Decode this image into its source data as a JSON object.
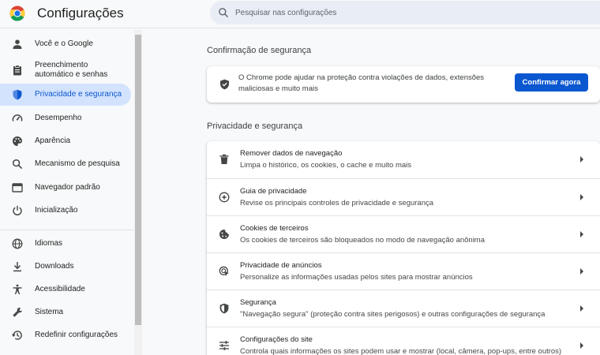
{
  "header": {
    "title": "Configurações",
    "search_placeholder": "Pesquisar nas configurações"
  },
  "sidebar": {
    "items": [
      {
        "label": "Você e o Google",
        "icon": "person-icon",
        "active": false
      },
      {
        "label": "Preenchimento automático e senhas",
        "icon": "clipboard-icon",
        "active": false
      },
      {
        "label": "Privacidade e segurança",
        "icon": "shield-icon",
        "active": true
      },
      {
        "label": "Desempenho",
        "icon": "speedometer-icon",
        "active": false
      },
      {
        "label": "Aparência",
        "icon": "palette-icon",
        "active": false
      },
      {
        "label": "Mecanismo de pesquisa",
        "icon": "search-icon",
        "active": false
      },
      {
        "label": "Navegador padrão",
        "icon": "browser-icon",
        "active": false
      },
      {
        "label": "Inicialização",
        "icon": "power-icon",
        "active": false
      },
      {
        "label": "Idiomas",
        "icon": "globe-icon",
        "active": false
      },
      {
        "label": "Downloads",
        "icon": "download-icon",
        "active": false
      },
      {
        "label": "Acessibilidade",
        "icon": "accessibility-icon",
        "active": false
      },
      {
        "label": "Sistema",
        "icon": "wrench-icon",
        "active": false
      },
      {
        "label": "Redefinir configurações",
        "icon": "history-icon",
        "active": false
      }
    ]
  },
  "safety_check": {
    "section_title": "Confirmação de segurança",
    "text": "O Chrome pode ajudar na proteção contra violações de dados, extensões maliciosas e muito mais",
    "button": "Confirmar agora"
  },
  "privacy": {
    "section_title": "Privacidade e segurança",
    "rows": [
      {
        "title": "Remover dados de navegação",
        "subtitle": "Limpa o histórico, os cookies, o cache e muito mais",
        "icon": "trash-icon"
      },
      {
        "title": "Guia de privacidade",
        "subtitle": "Revise os principais controles de privacidade e segurança",
        "icon": "compass-icon"
      },
      {
        "title": "Cookies de terceiros",
        "subtitle": "Os cookies de terceiros são bloqueados no modo de navegação anônima",
        "icon": "cookie-icon"
      },
      {
        "title": "Privacidade de anúncios",
        "subtitle": "Personalize as informações usadas pelos sites para mostrar anúncios",
        "icon": "ads-privacy-icon"
      },
      {
        "title": "Segurança",
        "subtitle": "\"Navegação segura\" (proteção contra sites perigosos) e outras configurações de segurança",
        "icon": "security-shield-icon"
      },
      {
        "title": "Configurações do site",
        "subtitle": "Controla quais informações os sites podem usar e mostrar (local, câmera, pop-ups, entre outros)",
        "icon": "sliders-icon"
      }
    ]
  },
  "colors": {
    "accent": "#0b57d0",
    "active_nav_bg": "#d3e3fd",
    "background": "#f8f9fa"
  }
}
